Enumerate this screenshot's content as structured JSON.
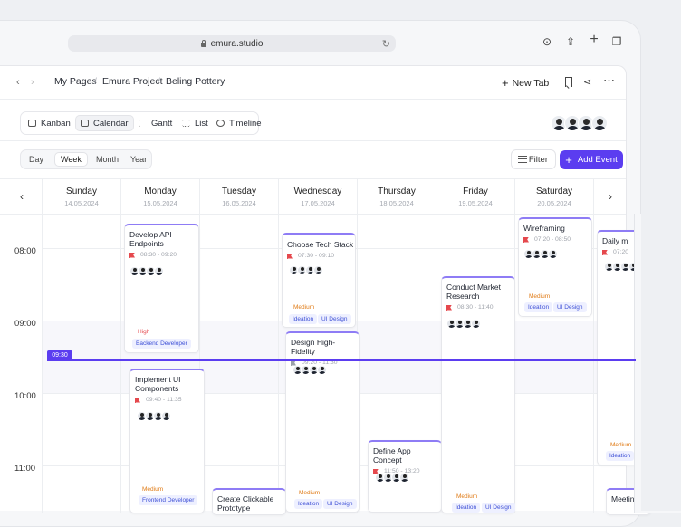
{
  "browser": {
    "url": "emura.studio"
  },
  "breadcrumbs": [
    "My Pages",
    "Emura Project",
    "Beling Pottery"
  ],
  "header": {
    "new_tab_label": "New Tab"
  },
  "views": [
    "Kanban",
    "Calendar",
    "Gantt",
    "List",
    "Timeline"
  ],
  "active_view": "Calendar",
  "ranges": [
    "Day",
    "Week",
    "Month",
    "Year"
  ],
  "active_range": "Week",
  "toolbar": {
    "filter_label": "Filter",
    "add_event_label": "Add Event"
  },
  "days": [
    {
      "name": "Sunday",
      "date": "14.05.2024"
    },
    {
      "name": "Monday",
      "date": "15.05.2024"
    },
    {
      "name": "Tuesday",
      "date": "16.05.2024"
    },
    {
      "name": "Wednesday",
      "date": "17.05.2024"
    },
    {
      "name": "Thursday",
      "date": "18.05.2024"
    },
    {
      "name": "Friday",
      "date": "19.05.2024"
    },
    {
      "name": "Saturday",
      "date": "20.05.2024"
    }
  ],
  "times": [
    "08:00",
    "09:00",
    "10:00",
    "11:00"
  ],
  "now": "09:30",
  "events": [
    {
      "title": "Develop API Endpoints",
      "time": "08:30 - 09:20",
      "tags": [
        "High",
        "Backend Developer"
      ]
    },
    {
      "title": "Implement UI Components",
      "time": "09:40 - 11:35",
      "tags": [
        "Medium",
        "Frontend Developer"
      ]
    },
    {
      "title": "Create Clickable Prototype",
      "time": "",
      "tags": []
    },
    {
      "title": "Choose Tech Stack",
      "time": "07:30 - 09:10",
      "tags": [
        "Medium",
        "Ideation",
        "UI Design"
      ]
    },
    {
      "title": "Design High-Fidelity",
      "time": "09:20 - 11:30",
      "tags": [
        "Medium",
        "Ideation",
        "UI Design"
      ]
    },
    {
      "title": "Define App Concept",
      "time": "11:50 - 13:20",
      "tags": []
    },
    {
      "title": "Conduct Market Research",
      "time": "08:30 - 11:40",
      "tags": [
        "Medium",
        "Ideation",
        "UI Design"
      ]
    },
    {
      "title": "Wireframing",
      "time": "07:20 - 08:50",
      "tags": [
        "Medium",
        "Ideation",
        "UI Design"
      ]
    },
    {
      "title": "Daily m",
      "time": "07:20",
      "tags": [
        "Medium",
        "Ideation"
      ]
    },
    {
      "title": "Meeting",
      "time": "",
      "tags": []
    }
  ]
}
